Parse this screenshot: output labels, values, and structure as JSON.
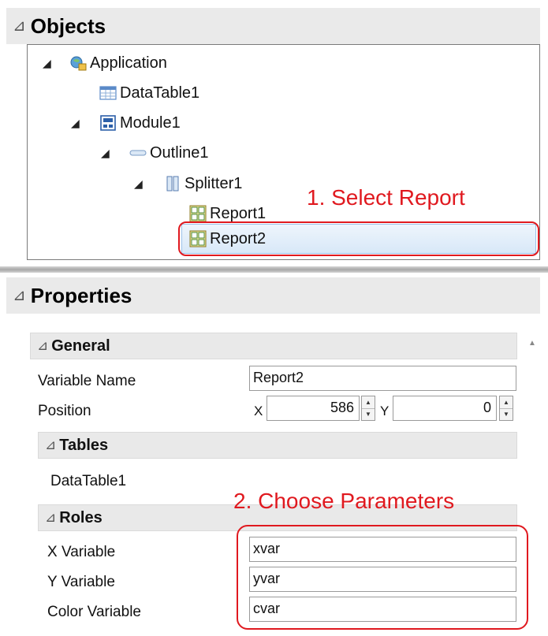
{
  "objects": {
    "title": "Objects",
    "tree": {
      "application": "Application",
      "datatable": "DataTable1",
      "module": "Module1",
      "outline": "Outline1",
      "splitter": "Splitter1",
      "report1": "Report1",
      "report2": "Report2"
    }
  },
  "properties": {
    "title": "Properties",
    "general": {
      "title": "General",
      "variable_name_label": "Variable Name",
      "variable_name_value": "Report2",
      "position_label": "Position",
      "x_label": "X",
      "x_value": "586",
      "y_label": "Y",
      "y_value": "0"
    },
    "tables": {
      "title": "Tables",
      "item": "DataTable1"
    },
    "roles": {
      "title": "Roles",
      "x_variable_label": "X Variable",
      "x_variable_value": "xvar",
      "y_variable_label": "Y Variable",
      "y_variable_value": "yvar",
      "color_variable_label": "Color Variable",
      "color_variable_value": "cvar"
    }
  },
  "annotations": {
    "select_report": "1. Select Report",
    "choose_parameters": "2. Choose Parameters"
  },
  "colors": {
    "annotation_red": "#e0191f",
    "selection_blue": "#d8e8f8"
  }
}
